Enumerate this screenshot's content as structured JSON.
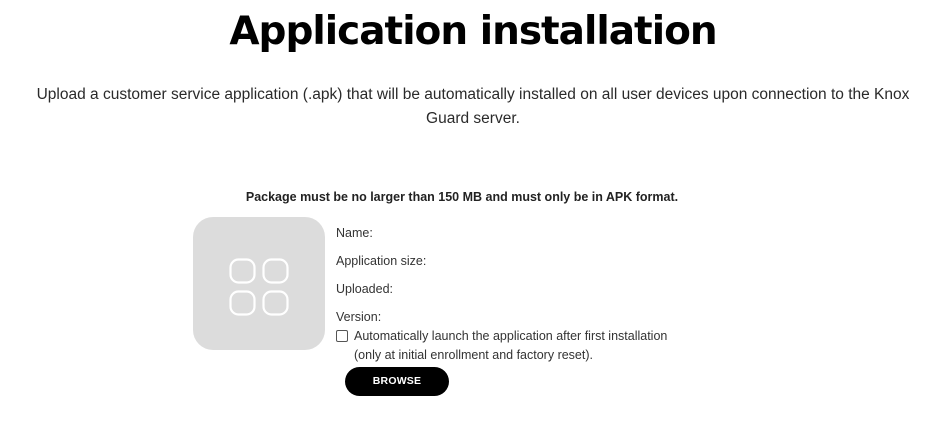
{
  "header": {
    "title": "Application installation",
    "subtitle_line1": "Upload a customer service application (.apk) that will be automatically installed on all user devices upon connection to the Knox",
    "subtitle_line2": "Guard server."
  },
  "upload": {
    "requirement_note": "Package must be no larger than 150 MB and must only be in APK format.",
    "app_icon": "apps-grid-icon",
    "fields": {
      "name_label": "Name:",
      "size_label": "Application size:",
      "uploaded_label": "Uploaded:",
      "version_label": "Version:"
    },
    "auto_launch": {
      "checked": false,
      "label_line1": "Automatically launch the application after first installation",
      "label_line2": "(only at initial enrollment and factory reset)."
    },
    "browse_label": "BROWSE"
  },
  "colors": {
    "icon_tile": "#dcdcdc",
    "button_bg": "#000000",
    "button_text": "#ffffff"
  }
}
